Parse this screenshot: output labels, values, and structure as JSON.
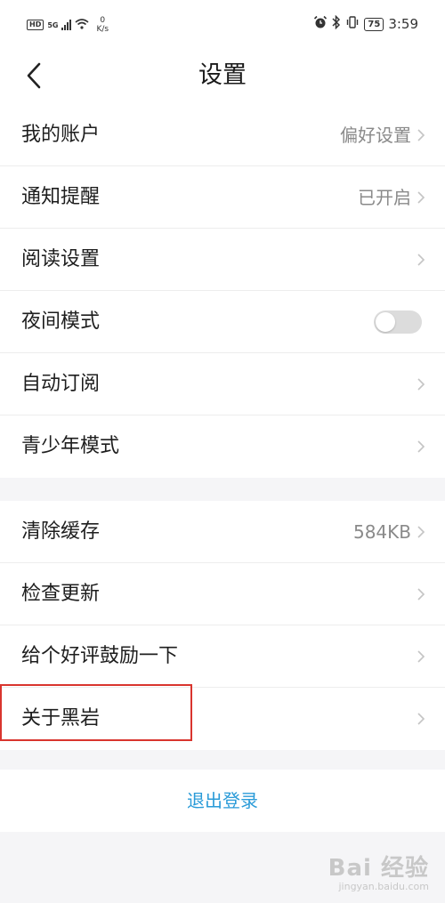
{
  "status_bar": {
    "hd": "HD",
    "network": "5G",
    "speed_value": "0",
    "speed_unit": "K/s",
    "battery": "75",
    "time": "3:59",
    "icons": [
      "alarm-icon",
      "bluetooth-icon",
      "vibrate-icon",
      "battery-icon",
      "signal-icon",
      "wifi-icon"
    ]
  },
  "header": {
    "back_icon": "chevron-left-icon",
    "title": "设置"
  },
  "groups": [
    {
      "items": [
        {
          "label": "我的账户",
          "value": "偏好设置",
          "control": "chevron"
        },
        {
          "label": "通知提醒",
          "value": "已开启",
          "control": "chevron"
        },
        {
          "label": "阅读设置",
          "value": "",
          "control": "chevron"
        },
        {
          "label": "夜间模式",
          "value": "",
          "control": "toggle",
          "toggle_on": false
        },
        {
          "label": "自动订阅",
          "value": "",
          "control": "chevron"
        },
        {
          "label": "青少年模式",
          "value": "",
          "control": "chevron"
        }
      ]
    },
    {
      "items": [
        {
          "label": "清除缓存",
          "value": "584KB",
          "control": "chevron"
        },
        {
          "label": "检查更新",
          "value": "",
          "control": "chevron"
        },
        {
          "label": "给个好评鼓励一下",
          "value": "",
          "control": "chevron"
        },
        {
          "label": "关于黑岩",
          "value": "",
          "control": "chevron"
        }
      ]
    }
  ],
  "logout": {
    "label": "退出登录"
  },
  "watermark": {
    "main": "Bai 经验",
    "sub": "jingyan.baidu.com"
  },
  "colors": {
    "accent": "#2a9bd8",
    "highlight": "#d9352e",
    "background": "#f5f5f7",
    "toggle_off": "#dcdcdc"
  }
}
